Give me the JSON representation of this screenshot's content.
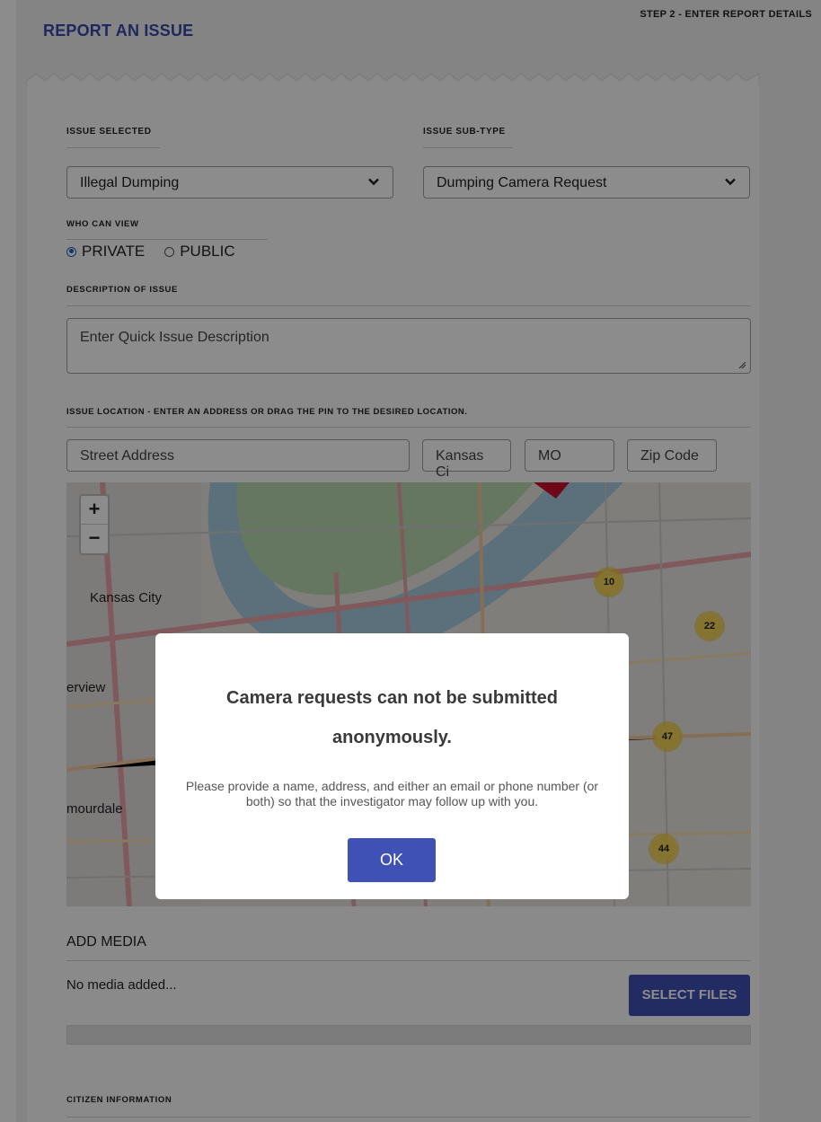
{
  "header": {
    "title": "REPORT AN ISSUE",
    "step": "STEP 2 - ENTER REPORT DETAILS"
  },
  "form": {
    "issue_selected_label": "ISSUE SELECTED",
    "issue_selected_value": "Illegal Dumping",
    "issue_subtype_label": "ISSUE SUB-TYPE",
    "issue_subtype_value": "Dumping Camera Request",
    "who_can_view_label": "WHO CAN VIEW",
    "visibility_options": [
      "PRIVATE",
      "PUBLIC"
    ],
    "visibility_selected": "PRIVATE",
    "description_label": "DESCRIPTION OF ISSUE",
    "description_placeholder": "Enter Quick Issue Description",
    "location_label": "ISSUE LOCATION - ENTER AN ADDRESS OR DRAG THE PIN TO THE DESIRED LOCATION.",
    "street_placeholder": "Street Address",
    "city_value": "Kansas Ci",
    "state_value": "MO",
    "zip_placeholder": "Zip Code"
  },
  "map": {
    "zoom_in": "+",
    "zoom_out": "−",
    "labels": [
      "Kansas City",
      "erview",
      "mourdale"
    ],
    "clusters": [
      "10",
      "22",
      "47",
      "44"
    ]
  },
  "media": {
    "title": "ADD MEDIA",
    "empty_text": "No media added...",
    "select_files": "SELECT FILES"
  },
  "citizen": {
    "label": "CITIZEN INFORMATION"
  },
  "modal": {
    "title": "Camera requests can not be submitted anonymously.",
    "message": "Please provide a name, address, and either an email or phone number (or both) so that the investigator may follow up with you.",
    "ok": "OK"
  },
  "colors": {
    "accent": "#3f51b5",
    "title": "#3949ab",
    "radio": "#1565c0",
    "cluster": "#f1d357"
  }
}
